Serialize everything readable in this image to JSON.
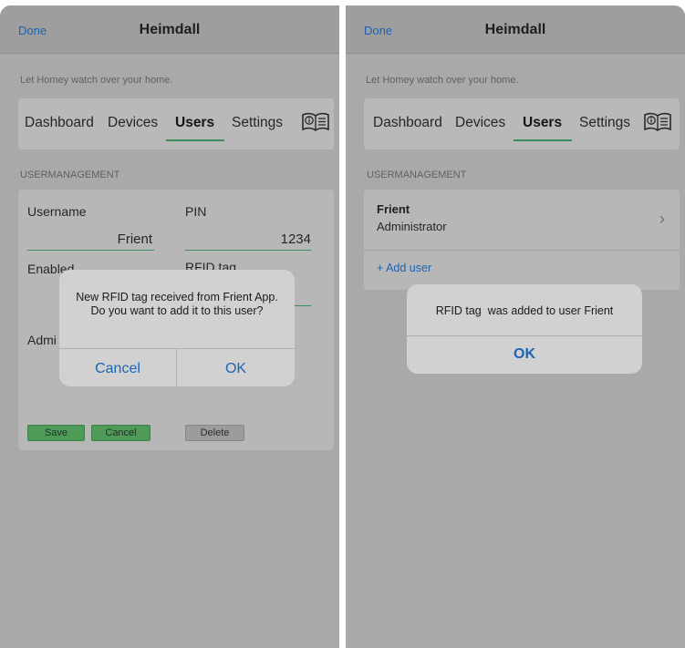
{
  "left_screen": {
    "header": {
      "done_label": "Done",
      "title": "Heimdall"
    },
    "subtitle": "Let Homey watch over your home.",
    "tabs": [
      "Dashboard",
      "Devices",
      "Users",
      "Settings"
    ],
    "active_tab": "Users",
    "section_label": "USERMANAGEMENT",
    "form": {
      "username_label": "Username",
      "username_value": "Frient",
      "pin_label": "PIN",
      "pin_value": "1234",
      "enabled_label": "Enabled",
      "rfid_label": "RFID tag",
      "admin_label_partial": "Admi",
      "save_label": "Save",
      "cancel_label": "Cancel",
      "delete_label": "Delete"
    },
    "dialog": {
      "message": "New RFID tag received from Frient App. Do you want to add it to this user?",
      "cancel_label": "Cancel",
      "ok_label": "OK"
    }
  },
  "right_screen": {
    "header": {
      "done_label": "Done",
      "title": "Heimdall"
    },
    "subtitle": "Let Homey watch over your home.",
    "tabs": [
      "Dashboard",
      "Devices",
      "Users",
      "Settings"
    ],
    "active_tab": "Users",
    "section_label": "USERMANAGEMENT",
    "user": {
      "name": "Frient",
      "role": "Administrator"
    },
    "add_user_label": "+ Add user",
    "dialog": {
      "message": "RFID tag  was added to user Frient",
      "ok_label": "OK"
    }
  },
  "colors": {
    "link_blue": "#1c64b4",
    "accent_green": "#3e8e5c",
    "overlay_gray": "#a9a9a9"
  },
  "icons": {
    "info": "book-info-icon",
    "chevron": "chevron-right-icon"
  }
}
